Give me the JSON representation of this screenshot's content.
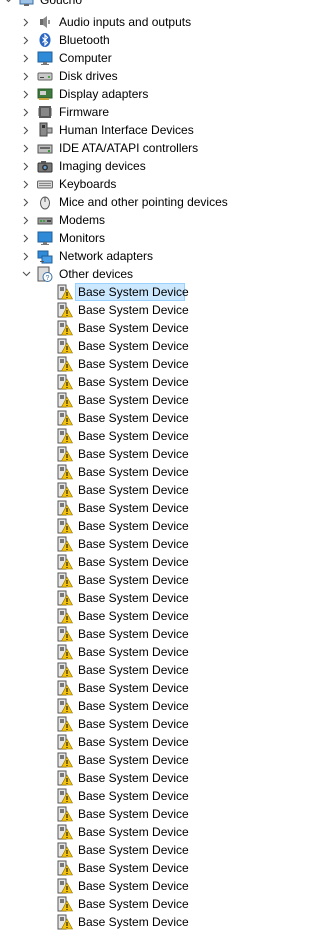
{
  "root": {
    "label": "Goucho",
    "icon": "computer-icon"
  },
  "categories": [
    {
      "label": "Audio inputs and outputs",
      "icon": "speaker-icon"
    },
    {
      "label": "Bluetooth",
      "icon": "bluetooth-icon"
    },
    {
      "label": "Computer",
      "icon": "monitor-icon"
    },
    {
      "label": "Disk drives",
      "icon": "disk-drive-icon"
    },
    {
      "label": "Display adapters",
      "icon": "display-adapter-icon"
    },
    {
      "label": "Firmware",
      "icon": "firmware-icon"
    },
    {
      "label": "Human Interface Devices",
      "icon": "hid-icon"
    },
    {
      "label": "IDE ATA/ATAPI controllers",
      "icon": "ide-controller-icon"
    },
    {
      "label": "Imaging devices",
      "icon": "camera-icon"
    },
    {
      "label": "Keyboards",
      "icon": "keyboard-icon"
    },
    {
      "label": "Mice and other pointing devices",
      "icon": "mouse-icon"
    },
    {
      "label": "Modems",
      "icon": "modem-icon"
    },
    {
      "label": "Monitors",
      "icon": "monitor-icon"
    },
    {
      "label": "Network adapters",
      "icon": "network-adapter-icon"
    },
    {
      "label": "Other devices",
      "icon": "unknown-device-icon",
      "expanded": true
    }
  ],
  "other_devices": {
    "item_label": "Base System Device",
    "count": 36,
    "selected_index": 0,
    "icon": "warning-device-icon"
  }
}
